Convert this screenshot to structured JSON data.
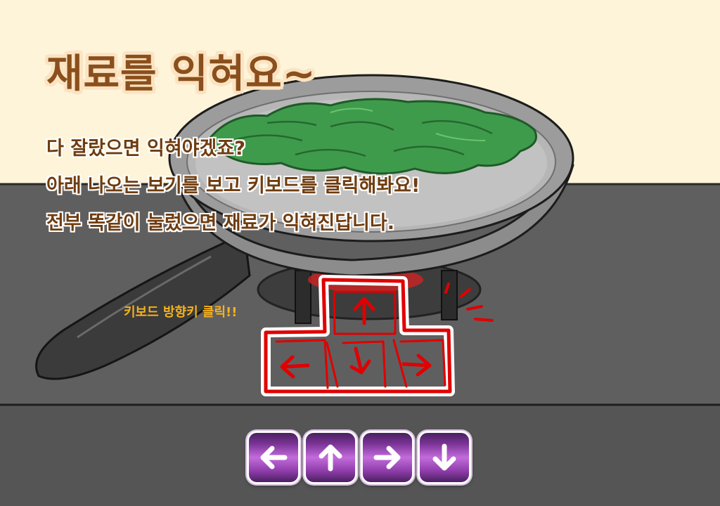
{
  "title": "재료를 익혀요~",
  "instructions": [
    "다 잘랐으면 익혀야겠죠?",
    "아래 나오는 보기를 보고 키보드를 클릭해봐요!",
    "전부 똑같이 눌렀으면 재료가 익혀진답니다."
  ],
  "keyboard_hint": "키보드 방향키 클릭!!",
  "arrow_sequence": [
    "left-arrow-icon",
    "up-arrow-icon",
    "right-arrow-icon",
    "down-arrow-icon"
  ],
  "colors": {
    "background": "#fdf4d9",
    "title": "#8a4f1c",
    "instruction_text": "#6f3c0f",
    "hint": "#f5b21c",
    "key_outline": "#e00000",
    "arrow_button": "#8d3ca8"
  }
}
